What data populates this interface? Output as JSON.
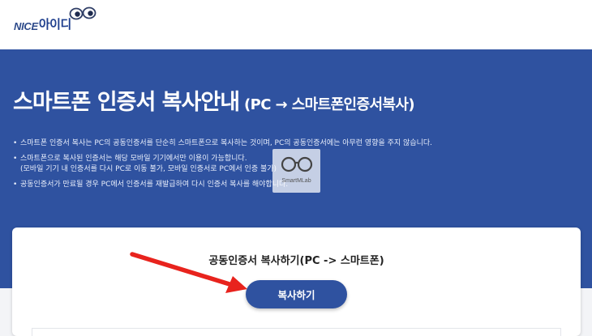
{
  "header": {
    "logo_en": "NICE",
    "logo_kr": "아이디",
    "logo_icon": "eyes-icon"
  },
  "banner": {
    "title": "스마트폰 인증서 복사안내",
    "subtitle": "(PC → 스마트폰인증서복사)",
    "notes": [
      {
        "text": "스마트폰 인증서 복사는 PC의 공동인증서를 단순히 스마트폰으로 복사하는 것이며, PC의 공동인증서에는 아무런 영향을 주지 않습니다."
      },
      {
        "text": "스마트폰으로 복사된 인증서는 해당 모바일 기기에서만 이용이 가능합니다.",
        "sub": "(모바일 기기 내 인증서를 다시 PC로 이동 불가, 모바일 인증서로 PC에서 인증 불가)"
      },
      {
        "text": "공동인증서가 만료될 경우 PC에서 인증서를 재발급하여 다시 인증서 복사를 해야합니다."
      }
    ]
  },
  "watermark": {
    "text": "SmartMLab",
    "icon": "glasses-icon"
  },
  "card": {
    "title": "공동인증서 복사하기(PC -> 스마트폰)",
    "button_label": "복사하기"
  },
  "colors": {
    "brand": "#2f52a0",
    "arrow": "#e8231d"
  }
}
